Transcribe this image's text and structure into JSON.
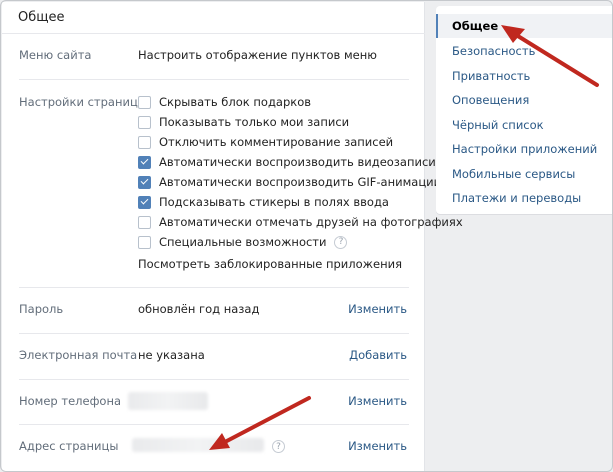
{
  "main": {
    "title": "Общее",
    "menu_label": "Меню сайта",
    "menu_link": "Настроить отображение пунктов меню",
    "page_settings_label": "Настройки страницы",
    "checkboxes": [
      {
        "label": "Скрывать блок подарков",
        "checked": false
      },
      {
        "label": "Показывать только мои записи",
        "checked": false
      },
      {
        "label": "Отключить комментирование записей",
        "checked": false
      },
      {
        "label": "Автоматически воспроизводить видеозаписи",
        "checked": true
      },
      {
        "label": "Автоматически воспроизводить GIF-анимации",
        "checked": true
      },
      {
        "label": "Подсказывать стикеры в полях ввода",
        "checked": true
      },
      {
        "label": "Автоматически отмечать друзей на фотографиях",
        "checked": false
      },
      {
        "label": "Специальные возможности",
        "checked": false
      }
    ],
    "help_glyph": "?",
    "blocked_apps_link": "Посмотреть заблокированные приложения",
    "password_label": "Пароль",
    "password_value": "обновлён год назад",
    "password_action": "Изменить",
    "email_label": "Электронная почта",
    "email_value": "не указана",
    "email_action": "Добавить",
    "phone_label": "Номер телефона",
    "phone_action": "Изменить",
    "address_label": "Адрес страницы",
    "address_action": "Изменить"
  },
  "sidebar": {
    "items": [
      {
        "label": "Общее",
        "active": true
      },
      {
        "label": "Безопасность"
      },
      {
        "label": "Приватность"
      },
      {
        "label": "Оповещения"
      },
      {
        "label": "Чёрный список"
      },
      {
        "label": "Настройки приложений"
      },
      {
        "label": "Мобильные сервисы"
      },
      {
        "label": "Платежи и переводы"
      }
    ]
  },
  "colors": {
    "link": "#2a5885",
    "checkbox_on": "#5181b8",
    "annotation_arrow": "#c0281f"
  }
}
